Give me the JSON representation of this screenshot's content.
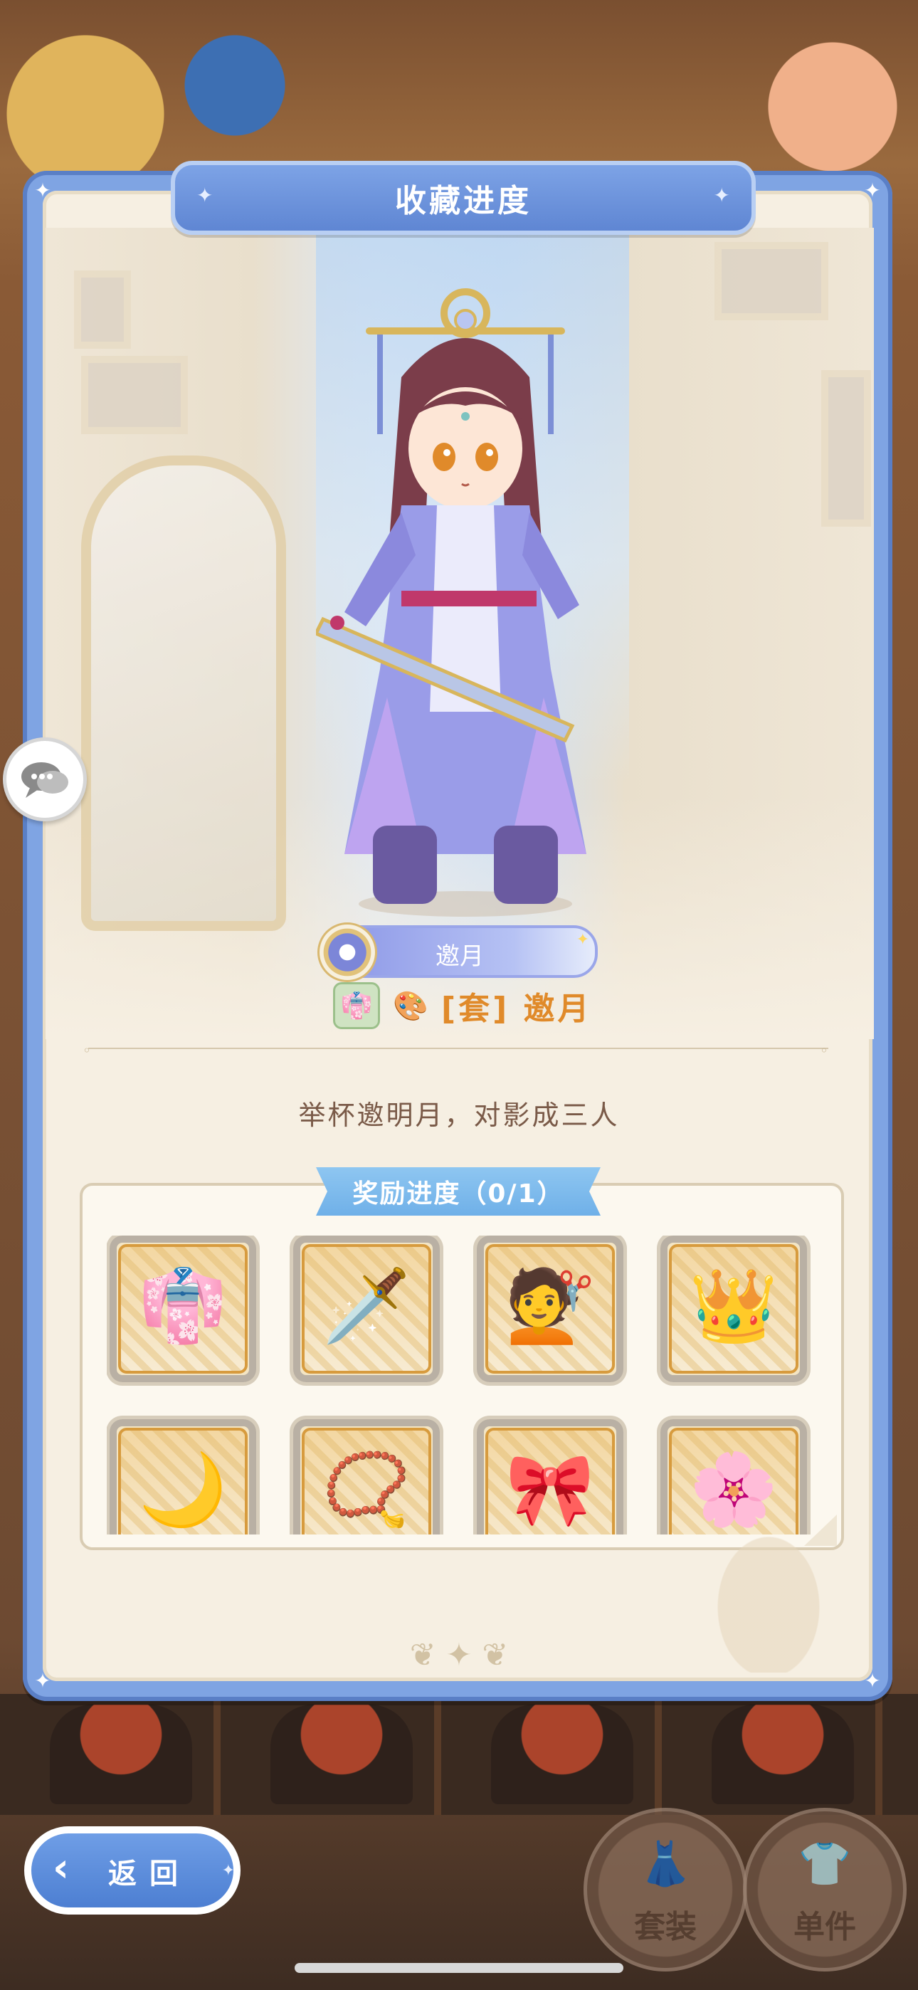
{
  "window": {
    "title": "收藏进度"
  },
  "character": {
    "name_plate": "邀月",
    "set_label": "[套] 邀月"
  },
  "quote": "举杯邀明月，对影成三人",
  "rewards": {
    "title": "奖励进度（0/1）",
    "items": [
      {
        "icon": "robe-icon"
      },
      {
        "icon": "sword-icon"
      },
      {
        "icon": "hairstyle-icon"
      },
      {
        "icon": "headpiece-icon"
      },
      {
        "icon": "crescent-ornament-icon"
      },
      {
        "icon": "necklace-icon"
      },
      {
        "icon": "hair-accessory-icon"
      },
      {
        "icon": "flower-icon"
      }
    ]
  },
  "nav": {
    "back_label": "返回"
  },
  "bottom_tabs": [
    {
      "label": "套装",
      "icon": "outfit-set-icon"
    },
    {
      "label": "单件",
      "icon": "single-item-icon"
    }
  ],
  "colors": {
    "panel_blue": "#7fa4e3",
    "label_orange": "#e08a2a",
    "tab_blue": "#6fb0e8",
    "panel_cream": "#f6efe2"
  }
}
